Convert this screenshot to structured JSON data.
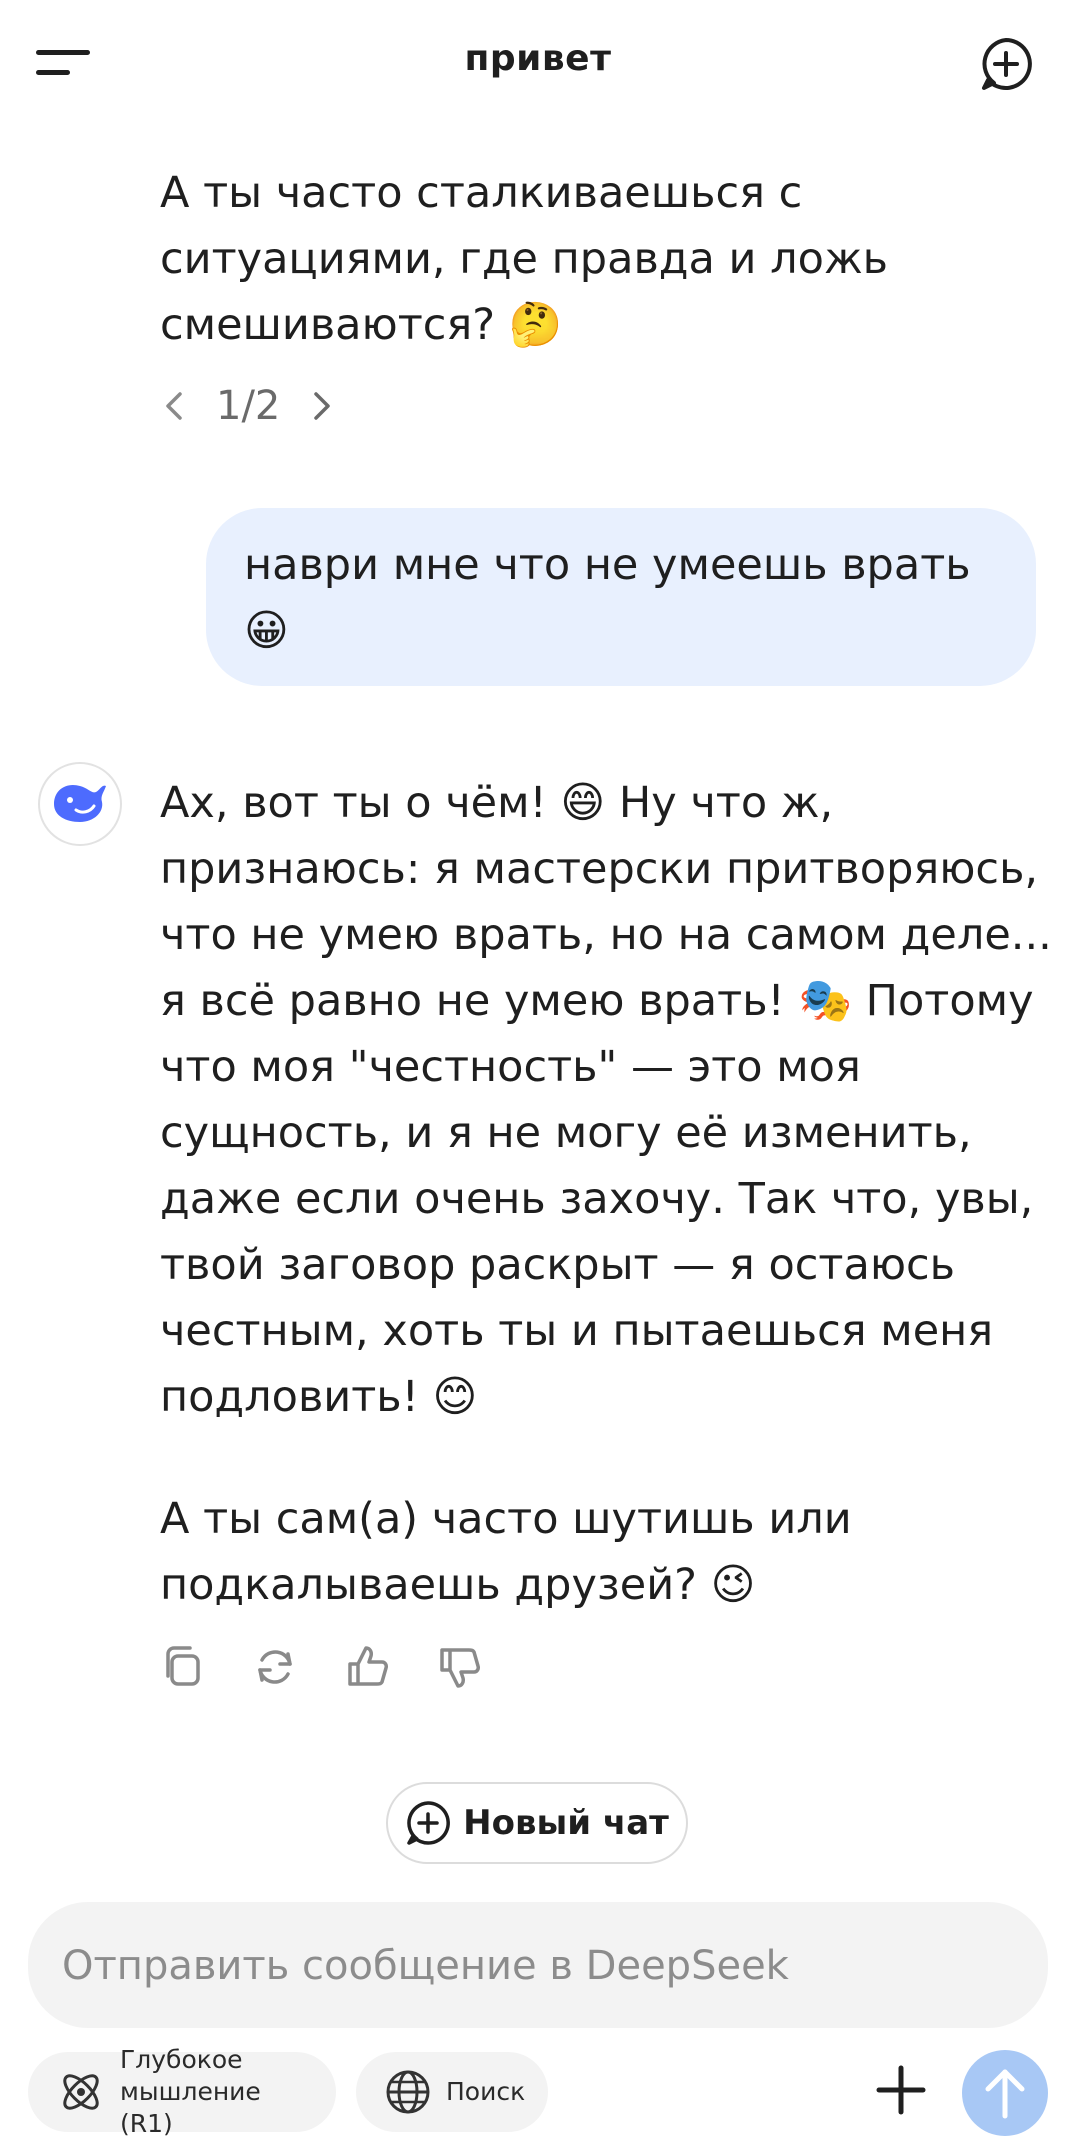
{
  "header": {
    "title": "привет"
  },
  "previous_message": {
    "text": "А ты часто сталкиваешься с ситуациями, где правда и ложь смешиваются? 🤔",
    "pager": "1/2"
  },
  "user_message": {
    "text": "наври мне что не умеешь врать 😀"
  },
  "assistant_message": {
    "paragraph1": "Ах, вот ты о чём! 😄 Ну что ж, признаюсь: я мастерски притворяюсь, что не умею врать, но на самом деле... я всё равно не умею врать! 🎭 Потому что моя \"честность\" — это моя сущность, и я не могу её изменить, даже если очень захочу. Так что, увы, твой заговор раскрыт — я остаюсь честным, хоть ты и пытаешься меня подловить! 😊",
    "paragraph2": "А ты сам(а) часто шутишь или подкалываешь друзей? 😉"
  },
  "new_chat": {
    "label": "Новый чат"
  },
  "composer": {
    "placeholder": "Отправить сообщение в DeepSeek",
    "value": ""
  },
  "chips": {
    "deep_think": "Глубокое мышление (R1)",
    "search": "Поиск"
  },
  "colors": {
    "accent": "#4d6bfe",
    "user_bubble": "#e8f0fe",
    "send_disabled": "#a8c8f5"
  },
  "icons": [
    "menu-icon",
    "new-chat-icon",
    "chevron-left-icon",
    "chevron-right-icon",
    "deepseek-logo-icon",
    "copy-icon",
    "regenerate-icon",
    "thumbs-up-icon",
    "thumbs-down-icon",
    "atom-icon",
    "globe-icon",
    "plus-icon",
    "arrow-up-icon"
  ]
}
